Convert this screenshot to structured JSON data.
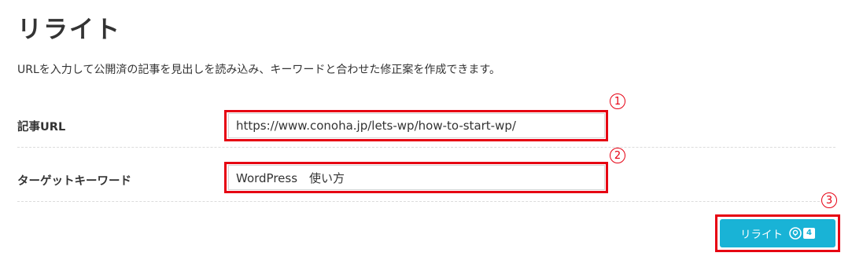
{
  "page_title": "リライト",
  "description": "URLを入力して公開済の記事を見出しを読み込み、キーワードと合わせた修正案を作成できます。",
  "form": {
    "url": {
      "label": "記事URL",
      "value": "https://www.conoha.jp/lets-wp/how-to-start-wp/",
      "marker": "1"
    },
    "keyword": {
      "label": "ターゲットキーワード",
      "value": "WordPress　使い方",
      "marker": "2"
    }
  },
  "submit": {
    "label": "リライト",
    "credit_icon": "coin-icon",
    "credit_count": "4",
    "marker": "3"
  },
  "colors": {
    "accent": "#19b3d6",
    "highlight": "#e60012",
    "text": "#333333"
  }
}
